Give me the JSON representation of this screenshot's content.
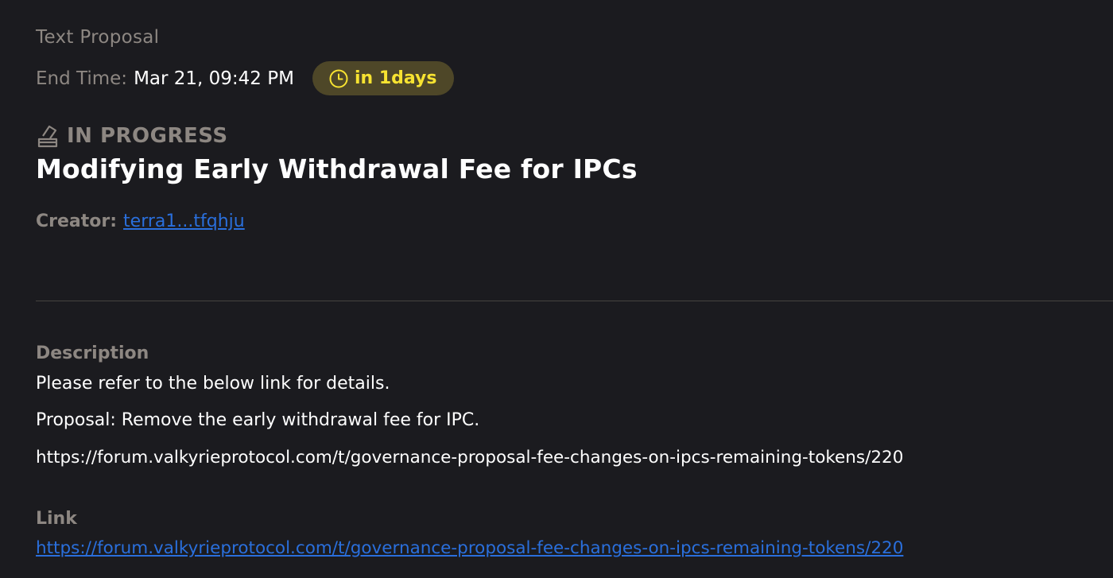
{
  "proposal": {
    "type": "Text Proposal",
    "end_time_label": "End Time:",
    "end_time_value": "Mar 21, 09:42 PM",
    "countdown": "in 1days",
    "countdown_icon": "clock-icon",
    "status_icon": "vote-box-icon",
    "status": "IN PROGRESS",
    "title": "Modifying Early Withdrawal Fee for IPCs",
    "creator_label": "Creator:",
    "creator_address": "terra1...tfqhju"
  },
  "description": {
    "heading": "Description",
    "lines": [
      "Please refer to the below link for details.",
      "Proposal: Remove the early withdrawal fee for IPC.",
      "https://forum.valkyrieprotocol.com/t/governance-proposal-fee-changes-on-ipcs-remaining-tokens/220"
    ]
  },
  "link": {
    "heading": "Link",
    "url": "https://forum.valkyrieprotocol.com/t/governance-proposal-fee-changes-on-ipcs-remaining-tokens/220"
  },
  "colors": {
    "background": "#1b1b1f",
    "muted_text": "#8d8782",
    "primary_text": "#ffffff",
    "badge_bg": "#4e4728",
    "badge_text": "#f7e331",
    "link": "#2a6fdc",
    "divider": "#46433f"
  }
}
